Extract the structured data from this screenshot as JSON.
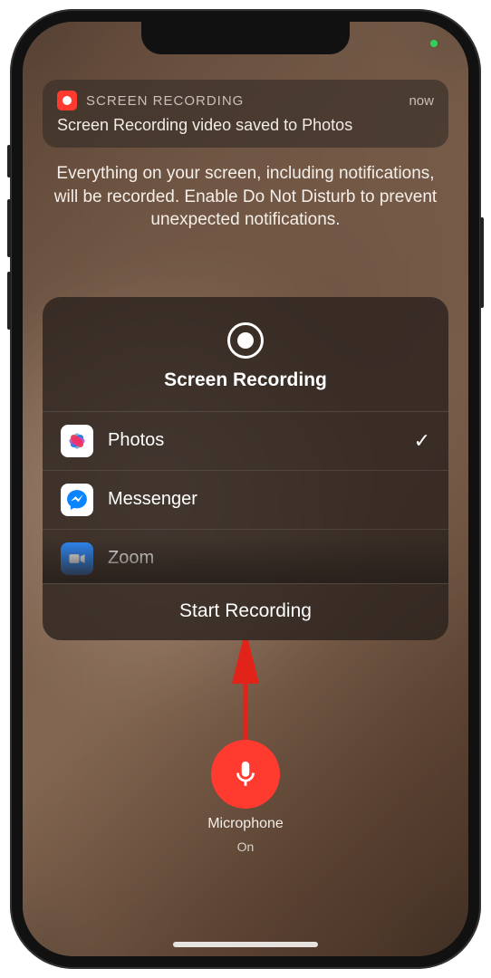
{
  "notification": {
    "app_name": "SCREEN RECORDING",
    "time": "now",
    "body": "Screen Recording video saved to Photos"
  },
  "info_text": "Everything on your screen, including notifications, will be recorded. Enable Do Not Disturb to prevent unexpected notifications.",
  "card": {
    "title": "Screen Recording",
    "destinations": {
      "photos": "Photos",
      "messenger": "Messenger",
      "zoom": "Zoom"
    },
    "selected_check": "✓",
    "start_label": "Start Recording"
  },
  "microphone": {
    "label": "Microphone",
    "state": "On"
  }
}
